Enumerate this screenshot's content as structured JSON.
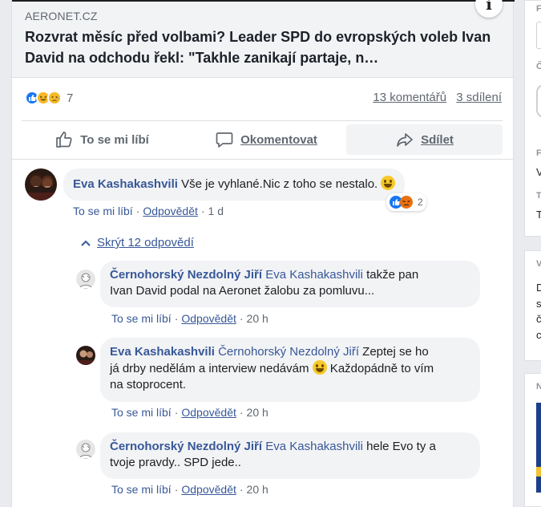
{
  "post": {
    "source": "AERONET.CZ",
    "headline": "Rozvrat měsíc před volbami? Leader SPD do evropských voleb Ivan David na odchodu řekl: \"Takhle zanikají partaje, n…",
    "info_icon": "i",
    "reaction_count": "7",
    "comments_count": "13 komentářů",
    "shares_count": "3 sdílení",
    "actions": {
      "like": "To se mi líbí",
      "comment": "Okomentovat",
      "share": "Sdílet"
    }
  },
  "comments": [
    {
      "author": "Eva Kashakashvili",
      "text": "Vše je vyhlané.Nic z toho se nestalo.",
      "like": "To se mi líbí",
      "reply": "Odpovědět",
      "time": "1 d",
      "reactions_count": "2"
    }
  ],
  "hide_replies": "Skrýt 12 odpovědí",
  "replies": [
    {
      "author": "Černohorský Nezdolný Jiří",
      "mention": "Eva Kashakashvili",
      "line1": " takže pan",
      "line2": "Ivan David podal na Aeronet žalobu za pomluvu...",
      "like": "To se mi líbí",
      "reply": "Odpovědět",
      "time": "20 h"
    },
    {
      "author": "Eva Kashakashvili",
      "mention": "Černohorský Nezdolný Jiří",
      "line1": " Zeptej se ho",
      "line2": "já drby nedělám a interview nedávám",
      "line2b": " Každopádně to vím",
      "line3": "na stoprocent.",
      "like": "To se mi líbí",
      "reply": "Odpovědět",
      "time": "20 h"
    },
    {
      "author": "Černohorský Nezdolný Jiří",
      "mention": "Eva Kashakashvili",
      "line1": " hele Evo ty a",
      "line2": "tvoje pravdy.. SPD jede..",
      "like": "To se mi líbí",
      "reply": "Odpovědět",
      "time": "20 h"
    }
  ],
  "right_column_letters": [
    "F",
    "Č",
    "F",
    "V",
    "T",
    "T",
    "V",
    "D",
    "s",
    "č",
    "c",
    "N"
  ],
  "colors": {
    "link": "#385898",
    "bubble": "#f2f3f5",
    "meta_grey": "#606770",
    "like_blue": "#1877f2",
    "emoji_yellow": "#f7b928"
  }
}
